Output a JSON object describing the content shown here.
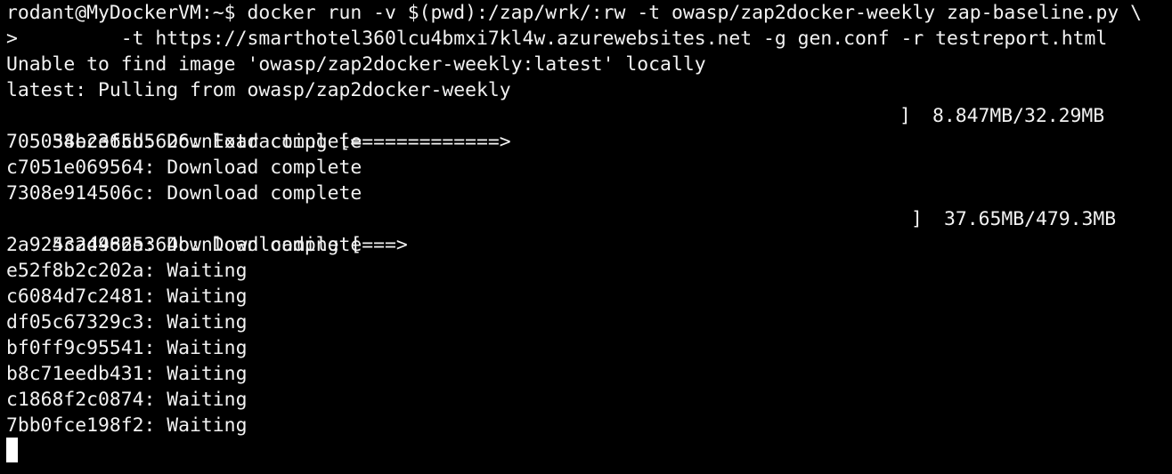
{
  "terminal": {
    "prompt": "rodant@MyDockerVM:~$ ",
    "command": "docker run -v $(pwd):/zap/wrk/:rw -t owasp/zap2docker-weekly zap-baseline.py \\",
    "continuation": ">         -t https://smarthotel360lcu4bmxi7kl4w.azurewebsites.net -g gen.conf -r testreport.html",
    "lines": [
      "Unable to find image 'owasp/zap2docker-weekly:latest' locally",
      "latest: Pulling from owasp/zap2docker-weekly"
    ],
    "progress": [
      {
        "text": "38e2e6cd5626: Extracting [=============>",
        "bracket_close": "]",
        "size": "8.847MB/32.29MB"
      },
      {
        "text": "4c2d4625364b: Downloading [===>",
        "bracket_close": "]",
        "size": "37.65MB/479.3MB"
      }
    ],
    "layers": [
      "705054bc3f5b: Download complete",
      "c7051e069564: Download complete",
      "7308e914506c: Download complete",
      "2a9253a4986e: Download complete",
      "e52f8b2c202a: Waiting",
      "c6084d7c2481: Waiting",
      "df05c67329c3: Waiting",
      "bf0ff9c95541: Waiting",
      "b8c71eedb431: Waiting",
      "c1868f2c0874: Waiting",
      "7bb0fce198f2: Waiting"
    ]
  },
  "colors": {
    "background": "#000000",
    "foreground": "#f2f2f2",
    "cursor": "#ffffff"
  }
}
